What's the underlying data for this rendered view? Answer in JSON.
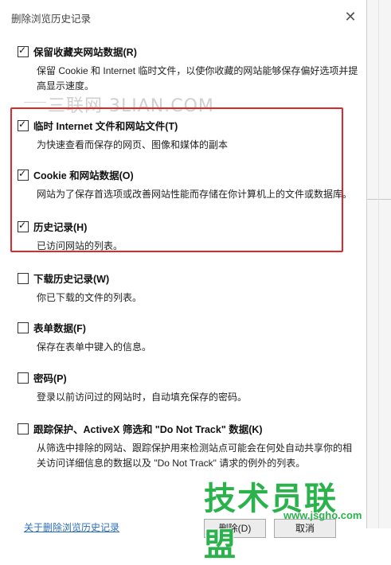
{
  "dialog": {
    "title": "删除浏览历史记录",
    "close_glyph": "✕"
  },
  "options": [
    {
      "label": "保留收藏夹网站数据(R)",
      "checked": true,
      "description": "保留 Cookie 和 Internet 临时文件，以使你收藏的网站能够保存偏好选项并提高显示速度。"
    },
    {
      "label": "临时 Internet 文件和网站文件(T)",
      "checked": true,
      "description": "为快速查看而保存的网页、图像和媒体的副本"
    },
    {
      "label": "Cookie 和网站数据(O)",
      "checked": true,
      "description": "网站为了保存首选项或改善网站性能而存储在你计算机上的文件或数据库。"
    },
    {
      "label": "历史记录(H)",
      "checked": true,
      "description": "已访问网站的列表。"
    },
    {
      "label": "下载历史记录(W)",
      "checked": false,
      "description": "你已下载的文件的列表。"
    },
    {
      "label": "表单数据(F)",
      "checked": false,
      "description": "保存在表单中键入的信息。"
    },
    {
      "label": "密码(P)",
      "checked": false,
      "description": "登录以前访问过的网站时，自动填充保存的密码。"
    },
    {
      "label": "跟踪保护、ActiveX 筛选和 \"Do Not Track\" 数据(K)",
      "checked": false,
      "description": "从筛选中排除的网站、跟踪保护用来检测站点可能会在何处自动共享你的相关访问详细信息的数据以及 \"Do Not Track\" 请求的例外的列表。"
    }
  ],
  "footer": {
    "link": "关于删除浏览历史记录",
    "delete_button": "删除(D)",
    "cancel_button": "取消"
  },
  "watermarks": {
    "top": "三联网 3LIAN.COM",
    "logo": "技术员联盟",
    "logo_url": "www.jsgho.com"
  },
  "colors": {
    "highlight": "#e0282b",
    "logo": "#2bb24c",
    "link": "#2a6ebb"
  }
}
